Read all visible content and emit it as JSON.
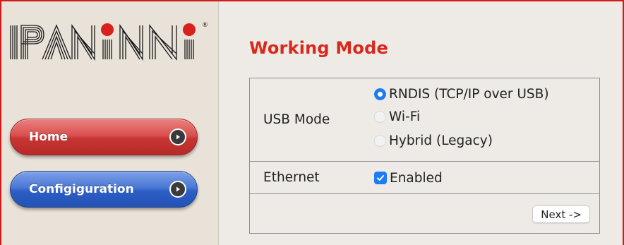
{
  "brand": {
    "logo_text": "PANINI",
    "registered_mark": "®",
    "logo_icon": "panini-logo"
  },
  "sidebar": {
    "items": [
      {
        "label": "Home",
        "color": "#c53533",
        "icon": "arrow-right-circle-icon"
      },
      {
        "label": "Configiguration",
        "color": "#2d5ec5",
        "icon": "arrow-right-circle-icon"
      }
    ]
  },
  "main": {
    "title": "Working Mode",
    "title_color": "#d9281c",
    "usb_mode": {
      "label": "USB Mode",
      "options": [
        {
          "label": "RNDIS (TCP/IP over USB)",
          "selected": true
        },
        {
          "label": "Wi-Fi",
          "selected": false
        },
        {
          "label": "Hybrid (Legacy)",
          "selected": false
        }
      ]
    },
    "ethernet": {
      "label": "Ethernet",
      "checkbox_label": "Enabled",
      "checked": true
    },
    "next_button": "Next ->",
    "accent_color": "#1c7cf4"
  }
}
